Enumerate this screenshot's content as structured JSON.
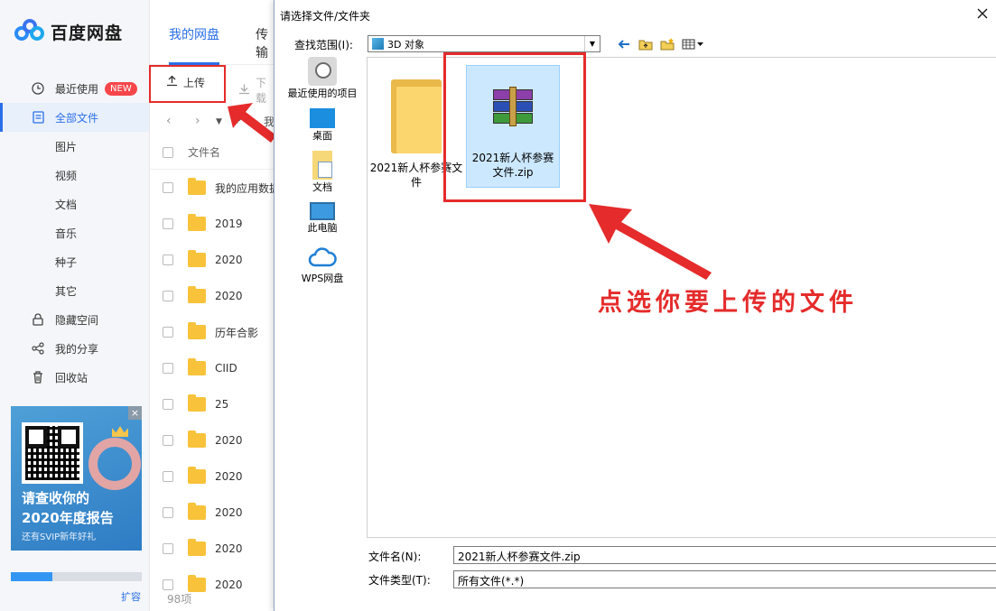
{
  "app": {
    "logo_text": "百度网盘",
    "tabs": [
      {
        "label": "我的网盘",
        "active": true
      },
      {
        "label": "传输",
        "active": false
      }
    ],
    "sidebar": {
      "items": [
        {
          "label": "最近使用",
          "icon": "clock-icon",
          "badge": "NEW"
        },
        {
          "label": "全部文件",
          "icon": "document-icon",
          "active": true
        },
        {
          "label": "图片",
          "sub": true
        },
        {
          "label": "视频",
          "sub": true
        },
        {
          "label": "文档",
          "sub": true
        },
        {
          "label": "音乐",
          "sub": true
        },
        {
          "label": "种子",
          "sub": true
        },
        {
          "label": "其它",
          "sub": true
        },
        {
          "label": "隐藏空间",
          "icon": "lock-icon"
        },
        {
          "label": "我的分享",
          "icon": "share-icon"
        },
        {
          "label": "回收站",
          "icon": "trash-icon"
        }
      ],
      "promo": {
        "line1": "请查收你的",
        "line2": "2020年度报告",
        "line3": "还有SVIP新年好礼",
        "close": "×"
      },
      "storage_used_fraction": 0.32,
      "expand_label": "扩容"
    },
    "toolbar": {
      "upload_label": "上传",
      "download_label": "下载"
    },
    "pathbar": {
      "partial_label": "我"
    },
    "file_list": {
      "header": "文件名",
      "rows": [
        "我的应用数据",
        "2019",
        "2020",
        "2020",
        "历年合影",
        "CIID",
        "25",
        "2020",
        "2020",
        "2020",
        "2020",
        "2020"
      ],
      "count": "98项"
    }
  },
  "dialog": {
    "title": "请选择文件/文件夹",
    "lookin_label": "查找范围(I):",
    "lookin_value": "3D 对象",
    "places": [
      "最近使用的项目",
      "桌面",
      "文档",
      "此电脑",
      "WPS网盘"
    ],
    "items": [
      {
        "name": "2021新人杯参赛文件",
        "type": "folder",
        "selected": false
      },
      {
        "name": "2021新人杯参赛文件.zip",
        "type": "zip",
        "selected": true
      }
    ],
    "filename_label": "文件名(N):",
    "filename_value": "2021新人杯参赛文件.zip",
    "filetype_label": "文件类型(T):",
    "filetype_value": "所有文件(*.*)"
  },
  "annotation": {
    "callout": "点选你要上传的文件",
    "color": "#e52b2b"
  }
}
